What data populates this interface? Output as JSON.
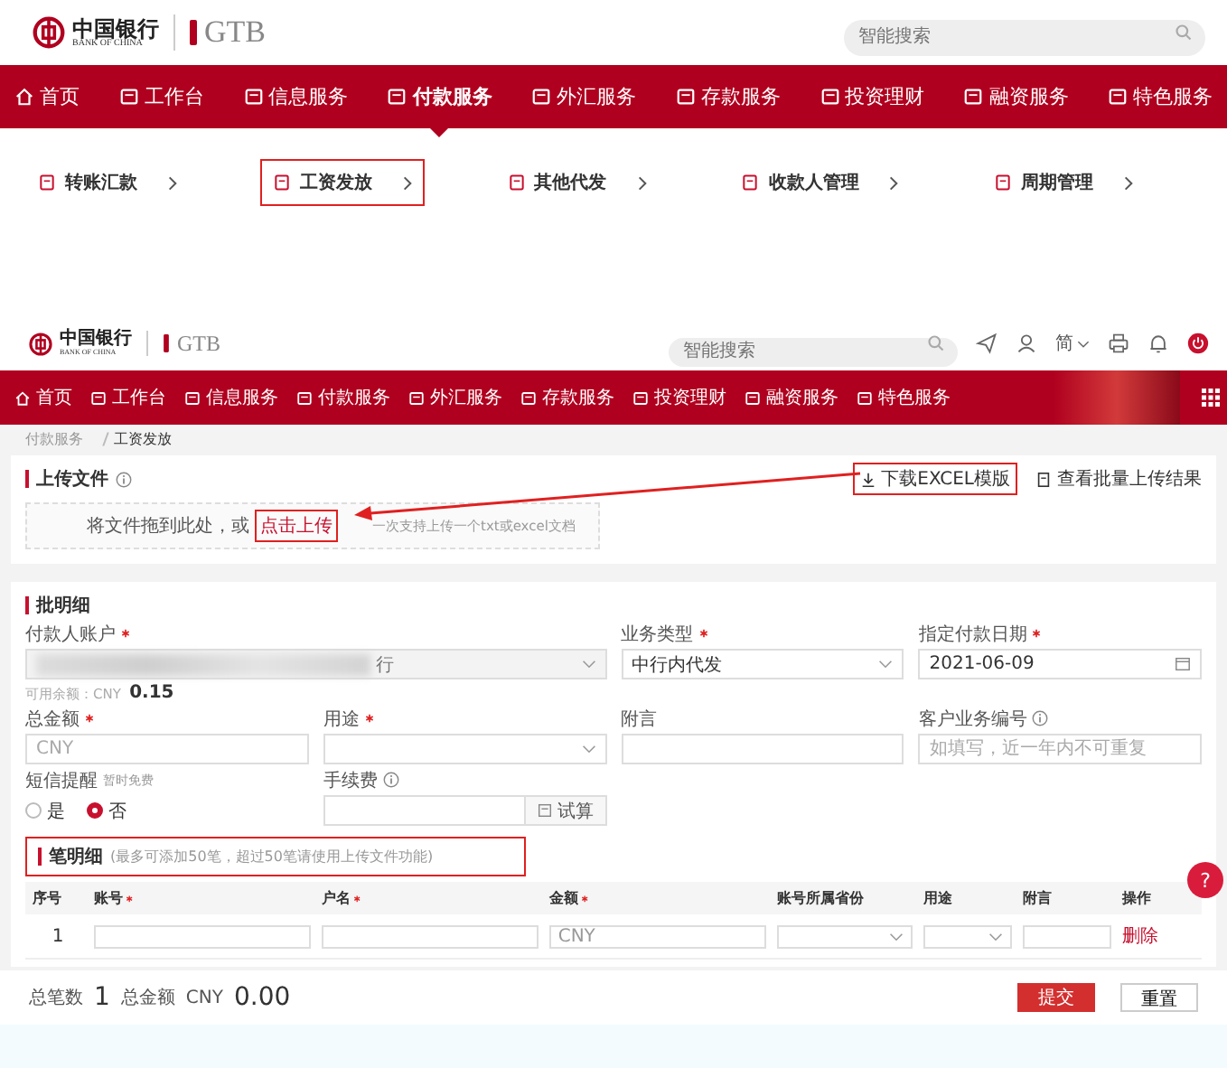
{
  "top": {
    "logo": {
      "cn": "中国银行",
      "en": "BANK OF CHINA",
      "brand": "GTB"
    },
    "search": {
      "placeholder": "智能搜索"
    },
    "nav": [
      {
        "label": "首页",
        "selected": false
      },
      {
        "label": "工作台",
        "selected": false
      },
      {
        "label": "信息服务",
        "selected": false
      },
      {
        "label": "付款服务",
        "selected": true
      },
      {
        "label": "外汇服务",
        "selected": false
      },
      {
        "label": "存款服务",
        "selected": false
      },
      {
        "label": "投资理财",
        "selected": false
      },
      {
        "label": "融资服务",
        "selected": false
      },
      {
        "label": "特色服务",
        "selected": false
      }
    ],
    "submenu": [
      {
        "label": "转账汇款",
        "highlighted": false
      },
      {
        "label": "工资发放",
        "highlighted": true
      },
      {
        "label": "其他代发",
        "highlighted": false
      },
      {
        "label": "收款人管理",
        "highlighted": false
      },
      {
        "label": "周期管理",
        "highlighted": false
      }
    ]
  },
  "app": {
    "logo": {
      "cn": "中国银行",
      "en": "BANK OF CHINA",
      "brand": "GTB"
    },
    "search": {
      "placeholder": "智能搜索"
    },
    "language": "简",
    "nav": [
      {
        "label": "首页"
      },
      {
        "label": "工作台"
      },
      {
        "label": "信息服务"
      },
      {
        "label": "付款服务"
      },
      {
        "label": "外汇服务"
      },
      {
        "label": "存款服务"
      },
      {
        "label": "投资理财"
      },
      {
        "label": "融资服务"
      },
      {
        "label": "特色服务"
      }
    ],
    "breadcrumb": [
      {
        "label": "付款服务",
        "current": false
      },
      {
        "label": "工资发放",
        "current": true
      }
    ],
    "upload": {
      "title": "上传文件",
      "download": {
        "label": "下载EXCEL模版",
        "highlighted": true
      },
      "results": "查看批量上传结果",
      "drop_text": "将文件拖到此处，或",
      "click_upload": {
        "label": "点击上传",
        "highlighted": true
      },
      "hint": "一次支持上传一个txt或excel文档"
    },
    "batch": {
      "title": "批明细",
      "payer": {
        "label": "付款人账户",
        "required": true,
        "value": "行",
        "balance_label": "可用余额：CNY",
        "balance": "0.15"
      },
      "fields": [
        {
          "kind": "select",
          "label": "业务类型",
          "required": true,
          "value": "中行内代发"
        },
        {
          "kind": "date",
          "label": "指定付款日期",
          "required": true,
          "value": "2021-06-09"
        },
        {
          "kind": "input",
          "label": "总金额",
          "required": true,
          "placeholder": "CNY"
        },
        {
          "kind": "select",
          "label": "用途",
          "required": true
        },
        {
          "kind": "input",
          "label": "附言",
          "required": false
        },
        {
          "kind": "input",
          "label": "客户业务编号",
          "required": false,
          "placeholder": "如填写，近一年内不可重复",
          "info": true
        }
      ],
      "sms": {
        "label": "短信提醒",
        "note": "暂时免费",
        "options": [
          {
            "label": "是",
            "selected": false
          },
          {
            "label": "否",
            "selected": true
          }
        ]
      },
      "fee": {
        "label": "手续费",
        "button": "试算"
      }
    },
    "details": {
      "title": "笔明细",
      "note": "(最多可添加50笔，超过50笔请使用上传文件功能)",
      "highlighted": true,
      "columns": [
        {
          "label": "序号",
          "required": false
        },
        {
          "label": "账号",
          "required": true
        },
        {
          "label": "户名",
          "required": true
        },
        {
          "label": "金额",
          "required": true
        },
        {
          "label": "账号所属省份",
          "required": false
        },
        {
          "label": "用途",
          "required": false
        },
        {
          "label": "附言",
          "required": false
        },
        {
          "label": "操作",
          "required": false
        }
      ],
      "rows": [
        {
          "index": "1",
          "amount_placeholder": "CNY",
          "action": "删除"
        }
      ]
    },
    "footer": {
      "count_label": "总笔数",
      "count": "1",
      "total_label": "总金额",
      "currency": "CNY",
      "total": "0.00",
      "submit": "提交",
      "reset": "重置"
    },
    "help": "?"
  }
}
